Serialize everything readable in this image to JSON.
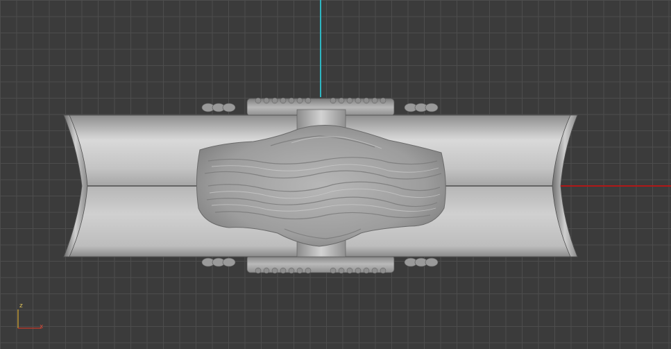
{
  "viewport": {
    "background_color": "#3b3b3b",
    "grid_color": "#4d4d4d",
    "axis_colors": {
      "vertical_axis": "#2fb6c2",
      "horizontal_axis": "#b01818"
    }
  },
  "gizmo": {
    "up_label": "z",
    "right_label": "x",
    "color": "#d8a830",
    "x_color": "#c83a2a"
  },
  "model": {
    "material_color": "#a9a9a9",
    "description_icon": "pipe-with-textured-patch"
  }
}
